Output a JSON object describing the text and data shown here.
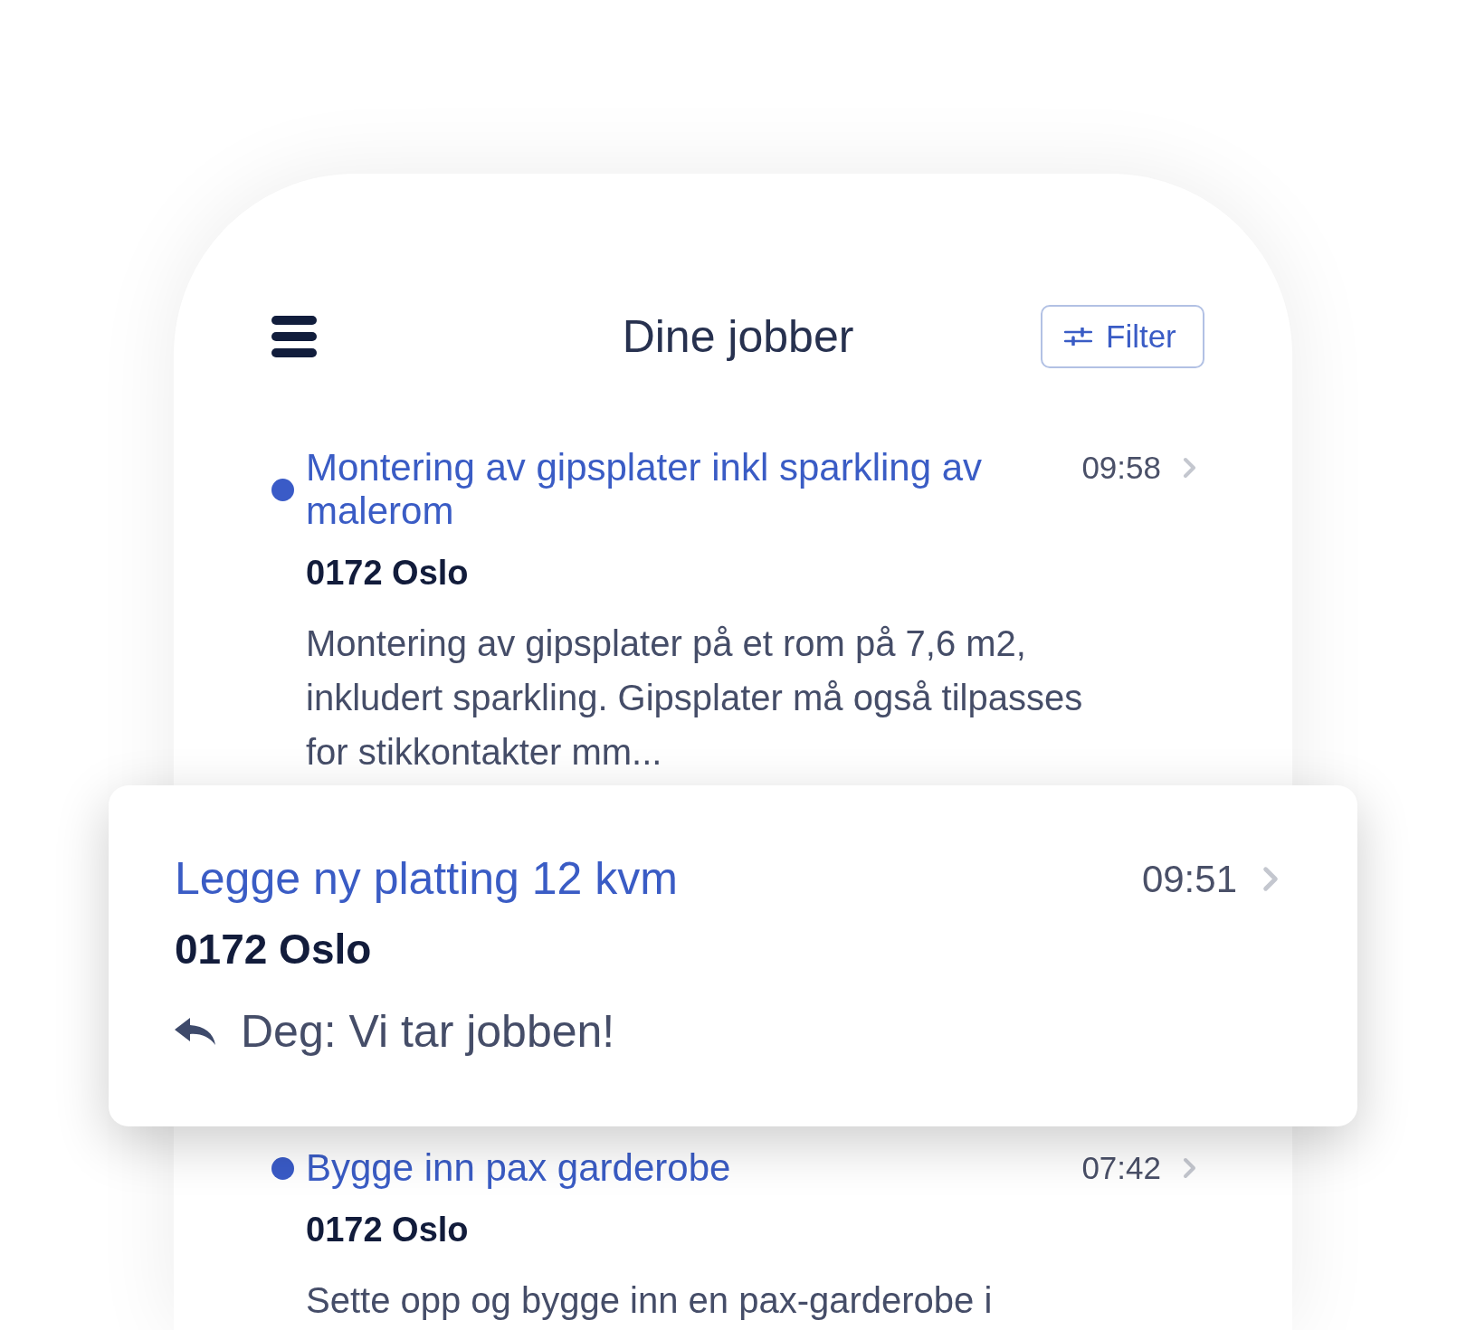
{
  "header": {
    "title": "Dine jobber",
    "filter_button": {
      "label": "Filter"
    }
  },
  "jobs": [
    {
      "title": "Montering av gipsplater inkl sparkling av malerom",
      "time": "09:58",
      "location": "0172 Oslo",
      "description": "Montering av gipsplater på et rom på 7,6 m2, inkludert sparkling. Gipsplater må også tilpasses for stikkontakter mm...",
      "unread": true,
      "highlighted": false
    },
    {
      "title": "Legge ny platting 12 kvm",
      "time": "09:51",
      "location": "0172 Oslo",
      "last_message": "Deg: Vi tar jobben!",
      "unread": false,
      "highlighted": true
    },
    {
      "title": "Bygge inn pax garderobe",
      "time": "07:42",
      "location": "0172 Oslo",
      "description": "Sette opp og bygge inn en pax-garderobe i",
      "unread": true,
      "highlighted": false
    }
  ]
}
